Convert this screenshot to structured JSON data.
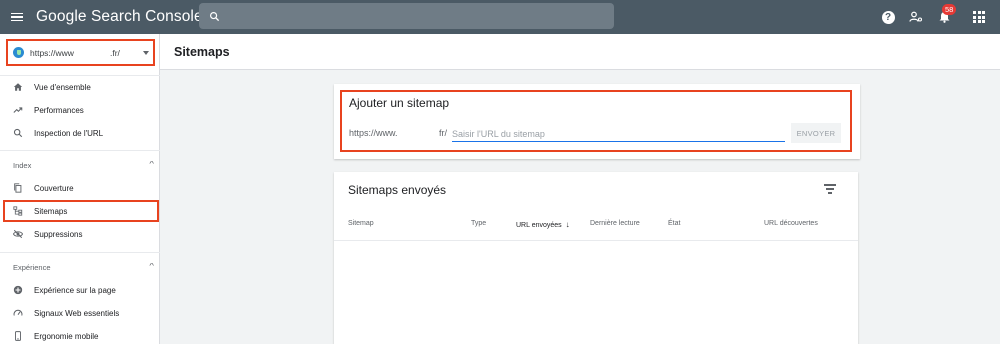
{
  "app": {
    "title": "Google Search Console"
  },
  "search": {
    "placeholder": ""
  },
  "topbar": {
    "notifications_count": "58"
  },
  "property": {
    "url_prefix": "https://www",
    "url_suffix": ".fr/"
  },
  "sidebar": {
    "items": [
      {
        "label": "Vue d'ensemble"
      },
      {
        "label": "Performances"
      },
      {
        "label": "Inspection de l'URL"
      }
    ],
    "sections": [
      {
        "title": "Index",
        "items": [
          {
            "label": "Couverture"
          },
          {
            "label": "Sitemaps"
          },
          {
            "label": "Suppressions"
          }
        ]
      },
      {
        "title": "Expérience",
        "items": [
          {
            "label": "Expérience sur la page"
          },
          {
            "label": "Signaux Web essentiels"
          },
          {
            "label": "Ergonomie mobile"
          }
        ]
      }
    ]
  },
  "page": {
    "title": "Sitemaps"
  },
  "add_sitemap": {
    "title": "Ajouter un sitemap",
    "base_url_prefix": "https://www.",
    "base_url_suffix": "fr/",
    "input_placeholder": "Saisir l'URL du sitemap",
    "submit_label": "ENVOYER"
  },
  "submitted": {
    "title": "Sitemaps envoyés",
    "columns": [
      "Sitemap",
      "Type",
      "URL envoyées",
      "Dernière lecture",
      "État",
      "URL découvertes"
    ]
  },
  "colors": {
    "topbar": "#4b5a65",
    "highlight": "#e8431f",
    "accent": "#1a73e8"
  }
}
